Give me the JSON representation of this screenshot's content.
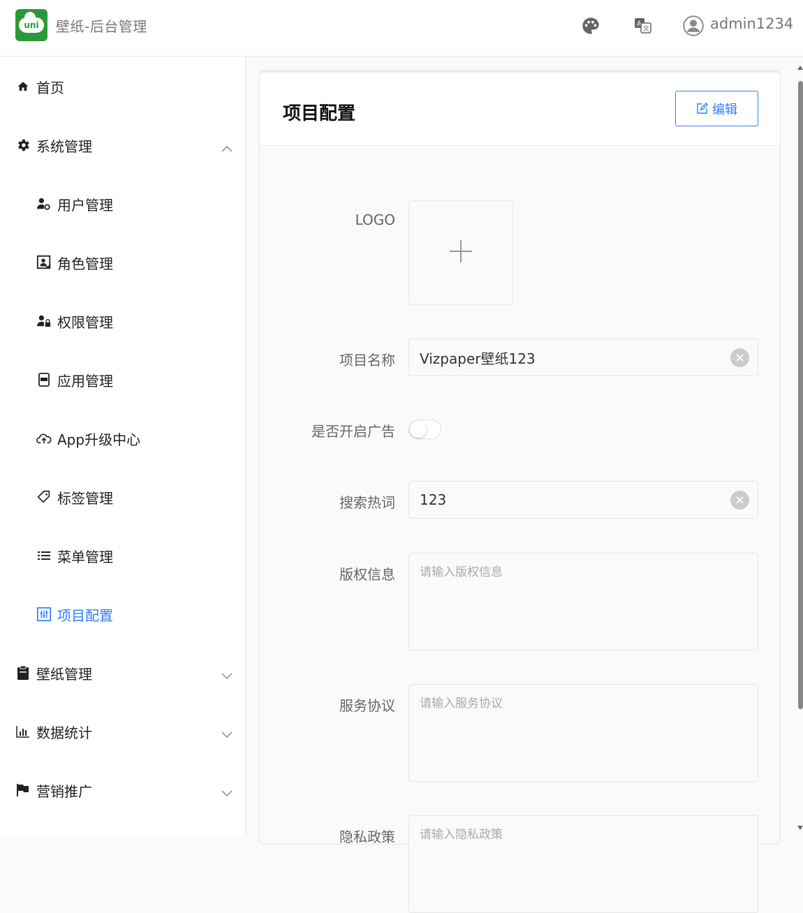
{
  "header": {
    "logo_text": "uni",
    "title": "壁纸-后台管理",
    "icons": [
      "palette-icon",
      "translate-icon",
      "user-avatar-icon"
    ],
    "username": "admin1234"
  },
  "sidebar": {
    "items": [
      {
        "label": "首页",
        "icon": "home-icon"
      },
      {
        "label": "系统管理",
        "icon": "gear-icon",
        "expanded": true
      },
      {
        "label": "用户管理",
        "icon": "user-gear-icon"
      },
      {
        "label": "角色管理",
        "icon": "role-icon"
      },
      {
        "label": "权限管理",
        "icon": "user-lock-icon"
      },
      {
        "label": "应用管理",
        "icon": "app-icon"
      },
      {
        "label": "App升级中心",
        "icon": "cloud-upload-icon"
      },
      {
        "label": "标签管理",
        "icon": "tag-icon"
      },
      {
        "label": "菜单管理",
        "icon": "list-icon"
      },
      {
        "label": "项目配置",
        "icon": "settings-sliders-icon",
        "active": true
      },
      {
        "label": "壁纸管理",
        "icon": "clipboard-icon",
        "expanded": false
      },
      {
        "label": "数据统计",
        "icon": "bar-chart-icon",
        "expanded": false
      },
      {
        "label": "营销推广",
        "icon": "flag-icon",
        "expanded": false
      }
    ]
  },
  "card": {
    "title": "项目配置",
    "edit_label": "编辑"
  },
  "form": {
    "logo_label": "LOGO",
    "name_label": "项目名称",
    "name_value": "Vizpaper壁纸123",
    "ads_label": "是否开启广告",
    "ads_enabled": false,
    "hotwords_label": "搜索热词",
    "hotwords_value": "123",
    "copyright_label": "版权信息",
    "copyright_placeholder": "请输入版权信息",
    "service_label": "服务协议",
    "service_placeholder": "请输入服务协议",
    "privacy_label": "隐私政策",
    "privacy_placeholder": "请输入隐私政策"
  },
  "colors": {
    "accent": "#2f7dfd",
    "brand_green": "#2b9939"
  }
}
